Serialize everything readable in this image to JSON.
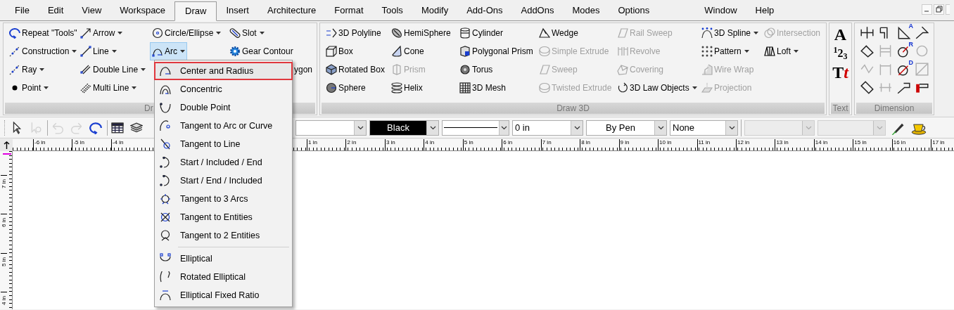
{
  "menu_bar": {
    "tabs": [
      {
        "label": "File",
        "selected": false
      },
      {
        "label": "Edit",
        "selected": false
      },
      {
        "label": "View",
        "selected": false
      },
      {
        "label": "Workspace",
        "selected": false
      },
      {
        "label": "Draw",
        "selected": true
      },
      {
        "label": "Insert",
        "selected": false
      },
      {
        "label": "Architecture",
        "selected": false
      },
      {
        "label": "Format",
        "selected": false
      },
      {
        "label": "Tools",
        "selected": false
      },
      {
        "label": "Modify",
        "selected": false
      },
      {
        "label": "Add-Ons",
        "selected": false
      },
      {
        "label": "AddOns",
        "selected": false
      },
      {
        "label": "Modes",
        "selected": false
      },
      {
        "label": "Options",
        "selected": false
      },
      {
        "label": "Window",
        "selected": false
      },
      {
        "label": "Help",
        "selected": false
      }
    ]
  },
  "ribbon": {
    "draw_group": {
      "label": "Dr",
      "columns": [
        [
          {
            "label": "Repeat \"Tools\"",
            "dropdown": false,
            "disabled": false,
            "open": false
          },
          {
            "label": "Construction",
            "dropdown": true,
            "disabled": false,
            "open": false
          },
          {
            "label": "Ray",
            "dropdown": true,
            "disabled": false,
            "open": false
          },
          {
            "label": "Point",
            "dropdown": true,
            "disabled": false,
            "open": false
          }
        ],
        [
          {
            "label": "Arrow",
            "dropdown": true,
            "disabled": false,
            "open": false
          },
          {
            "label": "Line",
            "dropdown": true,
            "disabled": false,
            "open": false
          },
          {
            "label": "Double Line",
            "dropdown": true,
            "disabled": false,
            "open": false
          },
          {
            "label": "Multi Line",
            "dropdown": true,
            "disabled": false,
            "open": false
          }
        ],
        [
          {
            "label": "Circle/Ellipse",
            "dropdown": true,
            "disabled": false,
            "open": false
          },
          {
            "label": "Arc",
            "dropdown": true,
            "disabled": false,
            "open": true
          }
        ],
        [
          {
            "label": "Slot",
            "dropdown": true,
            "disabled": false,
            "open": false
          },
          {
            "label": "Gear Contour",
            "dropdown": false,
            "disabled": false,
            "open": false
          },
          {
            "label": "ygon",
            "dropdown": false,
            "disabled": false,
            "open": false
          }
        ]
      ]
    },
    "draw3d_group": {
      "label": "Draw 3D",
      "columns": [
        [
          {
            "label": "3D Polyline",
            "dropdown": false,
            "disabled": false
          },
          {
            "label": "Box",
            "dropdown": false,
            "disabled": false
          },
          {
            "label": "Rotated Box",
            "dropdown": false,
            "disabled": false
          },
          {
            "label": "Sphere",
            "dropdown": false,
            "disabled": false
          }
        ],
        [
          {
            "label": "HemiSphere",
            "dropdown": false,
            "disabled": false
          },
          {
            "label": "Cone",
            "dropdown": false,
            "disabled": false
          },
          {
            "label": "Prism",
            "dropdown": false,
            "disabled": true
          },
          {
            "label": "Helix",
            "dropdown": false,
            "disabled": false
          }
        ],
        [
          {
            "label": "Cylinder",
            "dropdown": false,
            "disabled": false
          },
          {
            "label": "Polygonal Prism",
            "dropdown": false,
            "disabled": false
          },
          {
            "label": "Torus",
            "dropdown": false,
            "disabled": false
          },
          {
            "label": "3D Mesh",
            "dropdown": false,
            "disabled": false
          }
        ],
        [
          {
            "label": "Wedge",
            "dropdown": false,
            "disabled": false
          },
          {
            "label": "Simple Extrude",
            "dropdown": false,
            "disabled": true
          },
          {
            "label": "Sweep",
            "dropdown": false,
            "disabled": true
          },
          {
            "label": "Twisted Extrude",
            "dropdown": false,
            "disabled": true
          }
        ],
        [
          {
            "label": "Rail Sweep",
            "dropdown": false,
            "disabled": true
          },
          {
            "label": "Revolve",
            "dropdown": false,
            "disabled": true
          },
          {
            "label": "Covering",
            "dropdown": false,
            "disabled": true
          },
          {
            "label": "3D Law Objects",
            "dropdown": true,
            "disabled": false
          }
        ],
        [
          {
            "label": "3D Spline",
            "dropdown": true,
            "disabled": false
          },
          {
            "label": "Pattern",
            "dropdown": true,
            "disabled": false
          },
          {
            "label": "Wire Wrap",
            "dropdown": false,
            "disabled": true
          },
          {
            "label": "Projection",
            "dropdown": false,
            "disabled": true
          }
        ],
        [
          {
            "label": "Intersection",
            "dropdown": false,
            "disabled": true
          },
          {
            "label": "Loft",
            "dropdown": true,
            "disabled": false
          }
        ]
      ]
    },
    "text_group": {
      "label": "Text",
      "items": [
        {
          "text": "A"
        },
        {
          "text": "$^{1}$2$_{3}$"
        },
        {
          "text": "T",
          "accent": "t"
        }
      ]
    },
    "dimension_group": {
      "label": "Dimension",
      "tools": [
        {
          "disabled": false
        },
        {
          "disabled": false
        },
        {
          "badge": "A",
          "disabled": false
        },
        {
          "disabled": false
        },
        {
          "disabled": false
        },
        {
          "disabled": true
        },
        {
          "badge": "R",
          "disabled": false
        },
        {
          "disabled": true
        },
        {
          "disabled": true
        },
        {
          "disabled": true
        },
        {
          "badge": "D",
          "disabled": false
        },
        {
          "disabled": true
        },
        {
          "disabled": false
        },
        {
          "disabled": true
        },
        {
          "disabled": false
        },
        {
          "disabled": false
        }
      ]
    }
  },
  "toolbar": {
    "buttons": [
      {
        "disabled": false
      },
      {
        "disabled": true
      },
      {
        "disabled": true
      },
      {
        "disabled": true
      },
      {
        "disabled": false
      },
      {
        "disabled": false
      },
      {
        "disabled": false
      }
    ],
    "combos": [
      {
        "kind": "text",
        "disabled": false
      },
      {
        "kind": "color",
        "value": "Black",
        "disabled": false
      },
      {
        "kind": "line",
        "disabled": false
      },
      {
        "kind": "text",
        "value": "0 in",
        "disabled": false
      },
      {
        "kind": "centered",
        "value": "By Pen",
        "disabled": false
      },
      {
        "kind": "text",
        "value": "None",
        "disabled": false
      },
      {
        "kind": "text",
        "disabled": true
      },
      {
        "kind": "text",
        "disabled": true
      }
    ]
  },
  "rulers": {
    "horizontal_left": [
      "-6 in",
      "-5 in",
      "-4 in"
    ],
    "horizontal_right": [
      "1 in",
      "2 in",
      "3 in",
      "4 in",
      "5 in",
      "6 in",
      "7 in",
      "8 in",
      "9 in",
      "10 in",
      "11 in",
      "12 in",
      "13 in",
      "14 in",
      "15 in",
      "16 in",
      "17 in"
    ],
    "vertical": [
      "7 in",
      "6 in",
      "5 in",
      "4 in"
    ]
  },
  "arc_menu": {
    "items": [
      {
        "label": "Center and Radius",
        "selected": true
      },
      {
        "label": "Concentric",
        "selected": false
      },
      {
        "label": "Double Point",
        "selected": false
      },
      {
        "label": "Tangent to Arc or Curve",
        "selected": false
      },
      {
        "label": "Tangent to Line",
        "selected": false
      },
      {
        "label": "Start / Included / End",
        "selected": false
      },
      {
        "label": "Start / End / Included",
        "selected": false
      },
      {
        "label": "Tangent to 3 Arcs",
        "selected": false
      },
      {
        "label": "Tangent to Entities",
        "selected": false
      },
      {
        "label": "Tangent to 2 Entities",
        "selected": false
      },
      {
        "kind": "separator"
      },
      {
        "label": "Elliptical",
        "selected": false
      },
      {
        "label": "Rotated Elliptical",
        "selected": false
      },
      {
        "label": "Elliptical Fixed Ratio",
        "selected": false
      }
    ]
  }
}
